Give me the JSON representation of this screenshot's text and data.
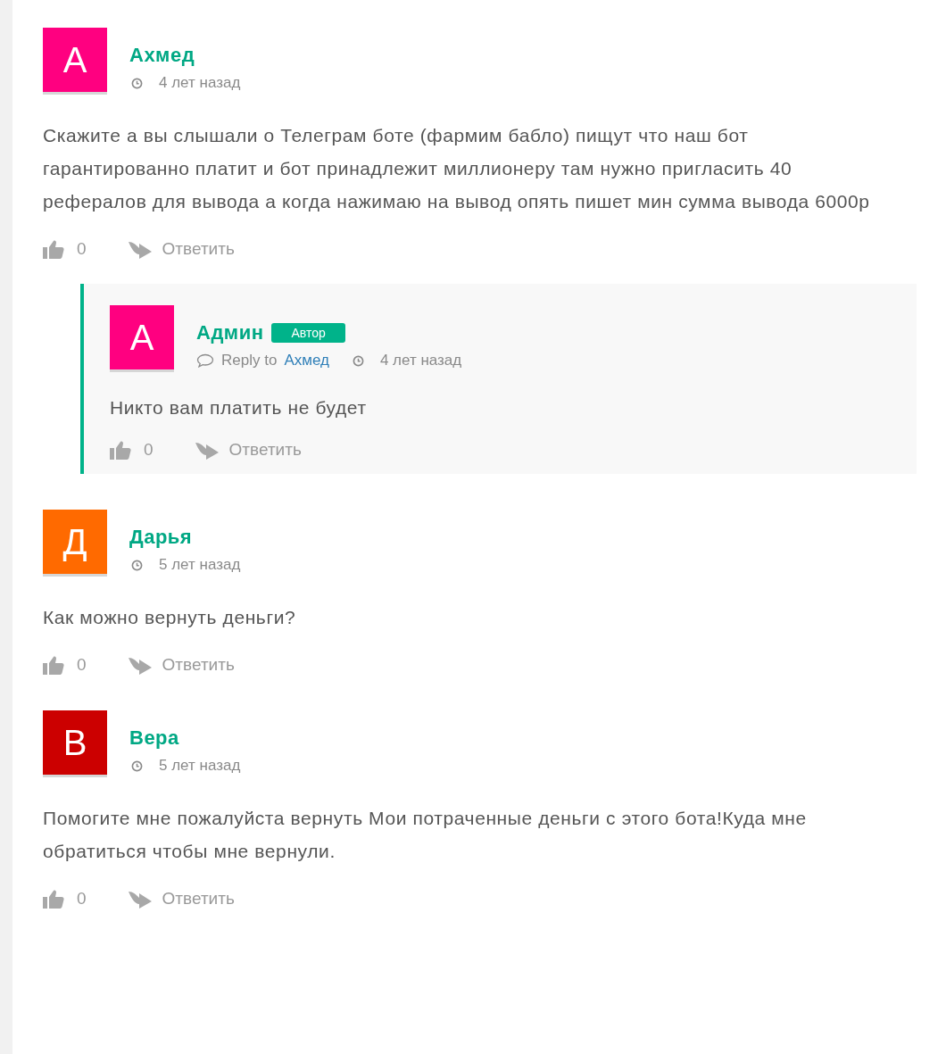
{
  "comments": [
    {
      "author": "Ахмед",
      "initial": "А",
      "color": "#ff0080",
      "time": "4 лет назад",
      "text": "Скажите а вы слышали о Телеграм боте (фармим бабло) пищут что наш бот гарантированно платит и бот принадлежит миллионеру там нужно пригласить 40 рефералов для вывода а когда нажимаю на вывод опять пишет мин сумма вывода 6000р",
      "likes": "0",
      "reply_label": "Ответить",
      "children": [
        {
          "author": "Админ",
          "badge": "Автор",
          "initial": "А",
          "color": "#ff0080",
          "reply_prefix": "Reply to",
          "reply_to": "Ахмед",
          "time": "4 лет назад",
          "text": "Никто вам платить не будет",
          "likes": "0",
          "reply_label": "Ответить"
        }
      ]
    },
    {
      "author": "Дарья",
      "initial": "Д",
      "color": "#ff6a00",
      "time": "5 лет назад",
      "text": "Как можно вернуть деньги?",
      "likes": "0",
      "reply_label": "Ответить"
    },
    {
      "author": "Вера",
      "initial": "В",
      "color": "#cc0000",
      "time": "5 лет назад",
      "text": "Помогите мне пожалуйста вернуть Мои потраченные деньги с этого бота!Куда мне обратиться чтобы мне вернули.",
      "likes": "0",
      "reply_label": "Ответить"
    }
  ]
}
